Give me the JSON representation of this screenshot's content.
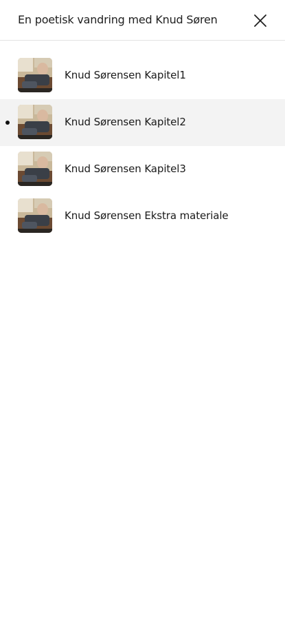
{
  "header": {
    "title": "En poetisk vandring med Knud Søren",
    "close_icon": "close-icon"
  },
  "chapters": [
    {
      "label": "Knud Sørensen Kapitel1",
      "active": false,
      "thumbnail": "chapter-thumbnail"
    },
    {
      "label": "Knud Sørensen Kapitel2",
      "active": true,
      "thumbnail": "chapter-thumbnail"
    },
    {
      "label": "Knud Sørensen Kapitel3",
      "active": false,
      "thumbnail": "chapter-thumbnail"
    },
    {
      "label": "Knud Sørensen Ekstra materiale",
      "active": false,
      "thumbnail": "chapter-thumbnail"
    }
  ],
  "colors": {
    "active_row_background": "#f3f3f3",
    "divider": "#e2e2e2",
    "text": "#1a1a1a"
  }
}
